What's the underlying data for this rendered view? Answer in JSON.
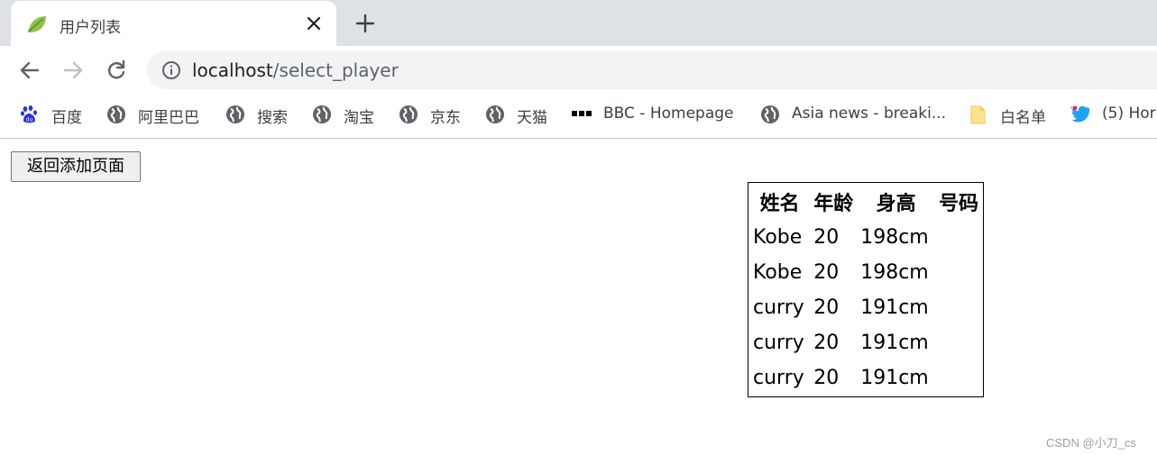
{
  "tab": {
    "title": "用户列表",
    "favicon": "leaf-icon"
  },
  "address_bar": {
    "host": "localhost",
    "path": "/select_player"
  },
  "bookmarks": [
    {
      "label": "百度",
      "icon": "baidu-paw-icon"
    },
    {
      "label": "阿里巴巴",
      "icon": "globe-icon"
    },
    {
      "label": "搜索",
      "icon": "globe-icon"
    },
    {
      "label": "淘宝",
      "icon": "globe-icon"
    },
    {
      "label": "京东",
      "icon": "globe-icon"
    },
    {
      "label": "天猫",
      "icon": "globe-icon"
    },
    {
      "label": "BBC - Homepage",
      "icon": "bbc-icon"
    },
    {
      "label": "Asia news - breaki...",
      "icon": "globe-icon"
    },
    {
      "label": "白名单",
      "icon": "folder-icon"
    },
    {
      "label": "(5) Hor",
      "icon": "twitter-icon"
    }
  ],
  "page": {
    "back_button": "返回添加页面",
    "table": {
      "headers": [
        "姓名",
        "年龄",
        "身高",
        "号码"
      ],
      "rows": [
        [
          "Kobe",
          "20",
          "198cm",
          ""
        ],
        [
          "Kobe",
          "20",
          "198cm",
          ""
        ],
        [
          "curry",
          "20",
          "191cm",
          ""
        ],
        [
          "curry",
          "20",
          "191cm",
          ""
        ],
        [
          "curry",
          "20",
          "191cm",
          ""
        ]
      ]
    }
  },
  "watermark": "CSDN @小刀_cs",
  "colors": {
    "tabstrip": "#dee1e6",
    "omnibox": "#f1f3f4",
    "baidu_blue": "#2932e1",
    "twitter_blue": "#1da1f2"
  }
}
